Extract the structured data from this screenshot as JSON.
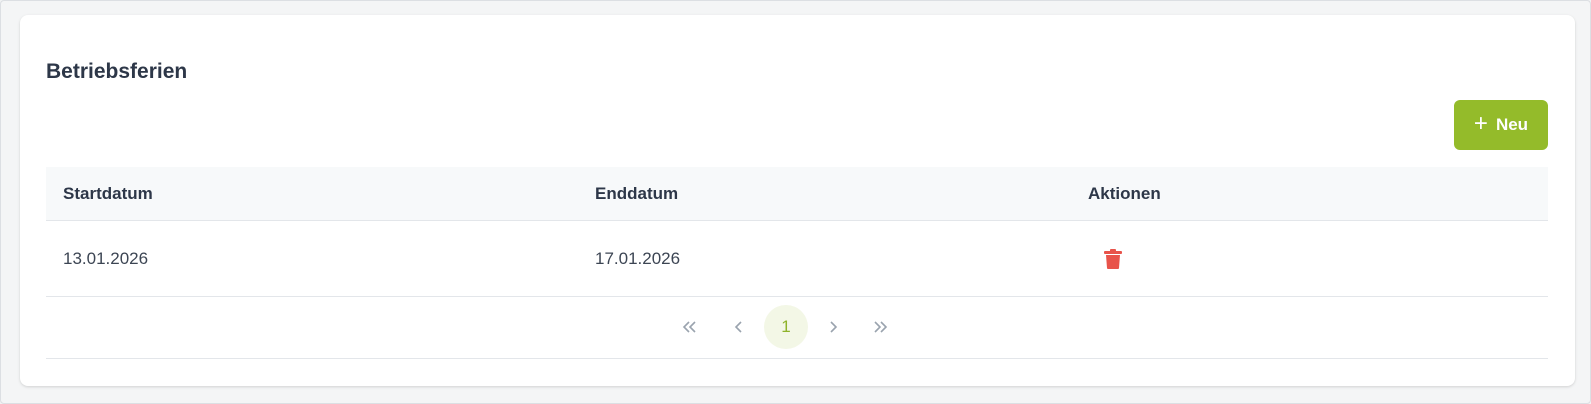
{
  "card": {
    "title": "Betriebsferien",
    "new_button_label": "Neu"
  },
  "table": {
    "columns": [
      "Startdatum",
      "Enddatum",
      "Aktionen"
    ],
    "rows": [
      {
        "start": "13.01.2026",
        "end": "17.01.2026",
        "action_icon": "trash-icon"
      }
    ]
  },
  "pagination": {
    "current_page": "1",
    "controls": [
      "first-page-icon",
      "previous-page-icon",
      "next-page-icon",
      "last-page-icon"
    ]
  },
  "colors": {
    "accent": "#94bb2a",
    "danger": "#e8534a",
    "current_page_bg": "#f3f7e6",
    "header_bg": "#f7f9fa"
  }
}
